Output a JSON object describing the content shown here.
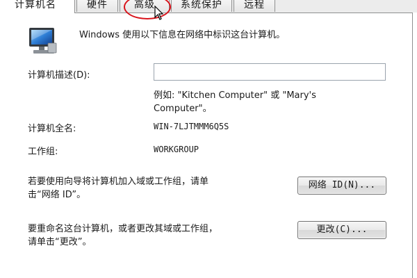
{
  "tabs": [
    {
      "label": "计算机名"
    },
    {
      "label": "硬件"
    },
    {
      "label": "高级"
    },
    {
      "label": "系统保护"
    },
    {
      "label": "远程"
    }
  ],
  "intro": "Windows 使用以下信息在网络中标识这台计算机。",
  "description_label": "计算机描述(D):",
  "description_value": "",
  "example_line1": "例如: \"Kitchen Computer\" 或 \"Mary's",
  "example_line2": "Computer\"。",
  "full_name_label": "计算机全名:",
  "full_name_value": "WIN-7LJTMMM6Q5S",
  "workgroup_label": "工作组:",
  "workgroup_value": "WORKGROUP",
  "network_text1": "若要使用向导将计算机加入域或工作组，请单",
  "network_text2": "击“网络 ID”。",
  "network_button": "网络 ID(N)...",
  "rename_text1": "要重命名这台计算机，或者更改其域或工作组，",
  "rename_text2": "请单击“更改”。",
  "change_button": "更改(C)...",
  "colors": {
    "highlight_circle": "#d9131b",
    "border": "#8e8f8f"
  },
  "icons": {
    "computer": "computer-monitor-icon",
    "cursor": "mouse-pointer-icon"
  }
}
